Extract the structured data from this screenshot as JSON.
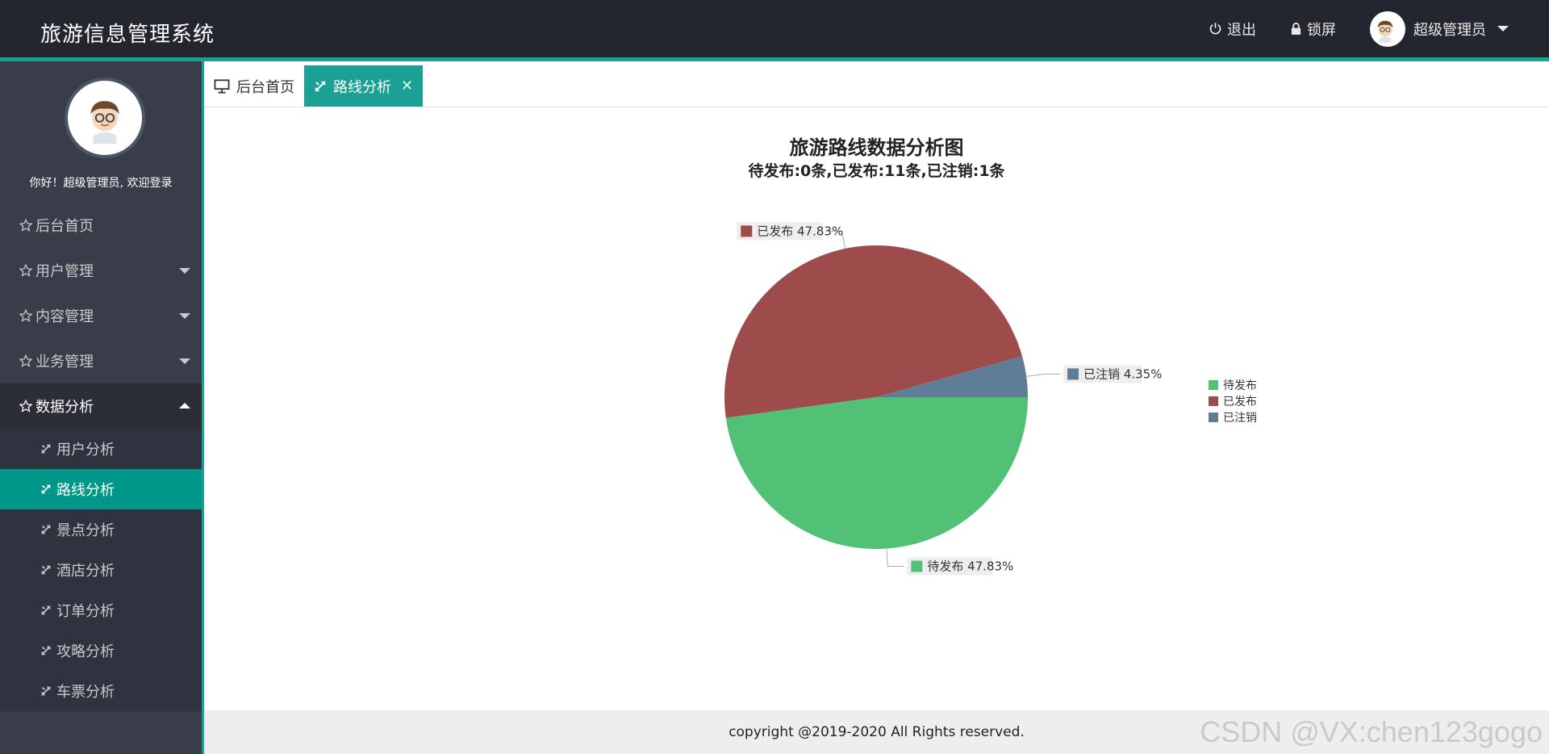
{
  "app": {
    "title": "旅游信息管理系统"
  },
  "header": {
    "logout": "退出",
    "lock": "锁屏",
    "user": "超级管理员"
  },
  "sidebar": {
    "welcome": "你好！超级管理员, 欢迎登录",
    "items": [
      {
        "label": "后台首页"
      },
      {
        "label": "用户管理"
      },
      {
        "label": "内容管理"
      },
      {
        "label": "业务管理"
      },
      {
        "label": "数据分析"
      }
    ],
    "subitems": [
      {
        "label": "用户分析"
      },
      {
        "label": "路线分析"
      },
      {
        "label": "景点分析"
      },
      {
        "label": "酒店分析"
      },
      {
        "label": "订单分析"
      },
      {
        "label": "攻略分析"
      },
      {
        "label": "车票分析"
      }
    ]
  },
  "tabs": [
    {
      "label": "后台首页"
    },
    {
      "label": "路线分析"
    }
  ],
  "chart_data": {
    "type": "pie",
    "title": "旅游路线数据分析图",
    "subtitle": "待发布:0条,已发布:11条,已注销:1条",
    "slices": [
      {
        "name": "待发布",
        "value": 47.83,
        "label": "待发布 47.83%",
        "color": "#52c176"
      },
      {
        "name": "已发布",
        "value": 47.83,
        "label": "已发布 47.83%",
        "color": "#9e4b4b"
      },
      {
        "name": "已注销",
        "value": 4.35,
        "label": "已注销 4.35%",
        "color": "#5f7d96"
      }
    ],
    "legend": {
      "placement": "right",
      "entries": [
        "待发布",
        "已发布",
        "已注销"
      ]
    }
  },
  "footer": {
    "text": "copyright @2019-2020 All Rights reserved."
  },
  "watermark": {
    "text": "CSDN @VX:chen123gogo"
  }
}
